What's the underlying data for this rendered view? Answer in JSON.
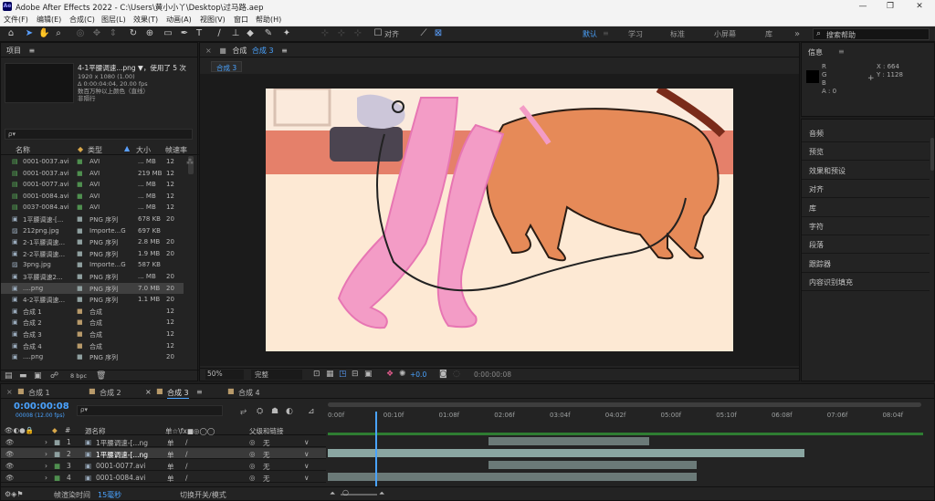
{
  "app": {
    "title": "Adobe After Effects 2022 - C:\\Users\\黄小小丫\\Desktop\\过马路.aep",
    "icon": "Ae"
  },
  "menu": [
    "文件(F)",
    "编辑(E)",
    "合成(C)",
    "图层(L)",
    "效果(T)",
    "动画(A)",
    "视图(V)",
    "窗口",
    "帮助(H)"
  ],
  "toolbar": {
    "snap_label": "对齐",
    "workspaces": [
      "默认",
      "学习",
      "标准",
      "小屏幕",
      "库"
    ],
    "active_workspace": "默认",
    "search_placeholder": "搜索帮助"
  },
  "project": {
    "tab": "项目",
    "menu": "≡",
    "thumb_title": "4-1平腰调速...png ▼，使用了 5 次",
    "thumb_info": [
      "1920 x 1080 (1.00)",
      "Δ 0:00:04:04, 20.00 fps",
      "数百万种以上颜色（直线）",
      "非隔行"
    ],
    "search_placeholder": "ρ▾",
    "columns": [
      "名称",
      "类型",
      "大小",
      "帧速率"
    ],
    "items": [
      {
        "name": "0001-0037.avi",
        "type": "AVI",
        "size": "... MB",
        "fps": "12",
        "icon": "avi-icon",
        "color": "#4f8f4f"
      },
      {
        "name": "0001-0037.avi",
        "type": "AVI",
        "size": "219 MB",
        "fps": "12",
        "icon": "avi-icon",
        "color": "#4f8f4f"
      },
      {
        "name": "0001-0077.avi",
        "type": "AVI",
        "size": "... MB",
        "fps": "12",
        "icon": "avi-icon",
        "color": "#4f8f4f"
      },
      {
        "name": "0001-0084.avi",
        "type": "AVI",
        "size": "... MB",
        "fps": "12",
        "icon": "avi-icon",
        "color": "#4f8f4f"
      },
      {
        "name": "0037-0084.avi",
        "type": "AVI",
        "size": "... MB",
        "fps": "12",
        "icon": "avi-icon",
        "color": "#4f8f4f"
      },
      {
        "name": "1平腰调速-[...",
        "type": "PNG 序列",
        "size": "678 KB",
        "fps": "20",
        "icon": "png-seq-icon",
        "color": "#8fa0a0"
      },
      {
        "name": "212png.jpg",
        "type": "Importe...G",
        "size": "697 KB",
        "fps": "",
        "icon": "jpg-icon",
        "color": "#8fa0a0"
      },
      {
        "name": "2-1平腰调速...",
        "type": "PNG 序列",
        "size": "2.8 MB",
        "fps": "20",
        "icon": "png-seq-icon",
        "color": "#8fa0a0"
      },
      {
        "name": "2-2平腰调速...",
        "type": "PNG 序列",
        "size": "1.9 MB",
        "fps": "20",
        "icon": "png-seq-icon",
        "color": "#8fa0a0"
      },
      {
        "name": "3png.jpg",
        "type": "Importe...G",
        "size": "587 KB",
        "fps": "",
        "icon": "jpg-icon",
        "color": "#8fa0a0"
      },
      {
        "name": "3平腰调速2...",
        "type": "PNG 序列",
        "size": "... MB",
        "fps": "20",
        "icon": "png-seq-icon",
        "color": "#8fa0a0"
      },
      {
        "name": "....png",
        "type": "PNG 序列",
        "size": "7.0 MB",
        "fps": "20",
        "icon": "png-seq-icon",
        "color": "#8fa0a0",
        "selected": true
      },
      {
        "name": "4-2平腰调速...",
        "type": "PNG 序列",
        "size": "1.1 MB",
        "fps": "20",
        "icon": "png-seq-icon",
        "color": "#8fa0a0"
      },
      {
        "name": "合成 1",
        "type": "合成",
        "size": "",
        "fps": "12",
        "icon": "comp-icon",
        "color": "#b89a6a"
      },
      {
        "name": "合成 2",
        "type": "合成",
        "size": "",
        "fps": "12",
        "icon": "comp-icon",
        "color": "#b89a6a"
      },
      {
        "name": "合成 3",
        "type": "合成",
        "size": "",
        "fps": "12",
        "icon": "comp-icon",
        "color": "#b89a6a"
      },
      {
        "name": "合成 4",
        "type": "合成",
        "size": "",
        "fps": "12",
        "icon": "comp-icon",
        "color": "#b89a6a"
      },
      {
        "name": "....png",
        "type": "PNG 序列",
        "size": "",
        "fps": "20",
        "icon": "png-seq-icon",
        "color": "#8fa0a0"
      }
    ],
    "bpc": "8 bpc"
  },
  "comp": {
    "tab": "合成 3",
    "breadcrumb": "合成 3",
    "zoom": "50%",
    "quality": "完整",
    "exposure": "+0.0",
    "timecode": "0:00:00:08"
  },
  "info": {
    "tab": "信息",
    "labels": [
      "R",
      "G",
      "B",
      "A : 0"
    ],
    "x": "X : 664",
    "y": "Y : 1128"
  },
  "right_panels": [
    "音频",
    "预览",
    "效果和预设",
    "对齐",
    "库",
    "字符",
    "段落",
    "跟踪器",
    "内容识别填充"
  ],
  "timeline": {
    "tabs": [
      "合成 1",
      "合成 2",
      "合成 3",
      "合成 4"
    ],
    "active_tab": "合成 3",
    "timecode": "0:00:00:08",
    "fps_info": "00008 (12.00 fps)",
    "search_placeholder": "ρ▾",
    "col_source": "源名称",
    "col_parent": "父级和链接",
    "col_switches": "单☆\\fx■◎◯◯",
    "ruler": [
      "0:00f",
      "00:10f",
      "01:08f",
      "02:06f",
      "03:04f",
      "04:02f",
      "05:00f",
      "05:10f",
      "06:08f",
      "07:06f",
      "08:04f"
    ],
    "playhead_fraction": 0.08,
    "layers": [
      {
        "num": "1",
        "name": "1平腰调速-[...ng",
        "parent": "无",
        "color": "#8fa0a0",
        "start": 0.27,
        "end": 0.54
      },
      {
        "num": "2",
        "name": "1平腰调速-[...ng",
        "parent": "无",
        "color": "#8fa0a0",
        "start": 0.0,
        "end": 0.8,
        "selected": true
      },
      {
        "num": "3",
        "name": "0001-0077.avi",
        "parent": "无",
        "color": "#4f8f4f",
        "start": 0.27,
        "end": 0.62
      },
      {
        "num": "4",
        "name": "0001-0084.avi",
        "parent": "无",
        "color": "#4f8f4f",
        "start": 0.0,
        "end": 0.62
      }
    ],
    "footer_render": "帧渲染时间",
    "footer_ms": "15毫秒",
    "footer_switch": "切换开关/模式"
  }
}
